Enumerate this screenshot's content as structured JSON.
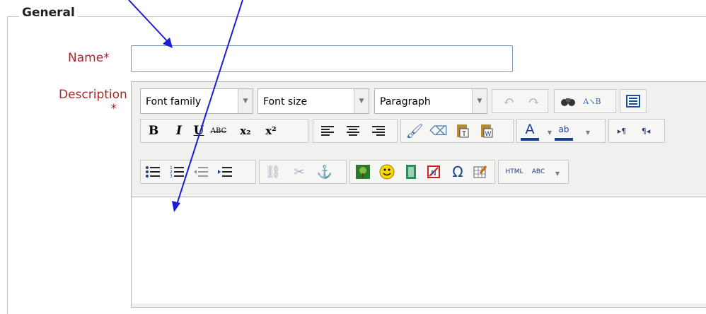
{
  "section": {
    "legend": "General"
  },
  "fields": {
    "name": {
      "label": "Name",
      "required": "*",
      "value": "",
      "placeholder": ""
    },
    "description": {
      "label": "Description",
      "required": "*"
    }
  },
  "toolbar": {
    "font_family": "Font family",
    "font_size": "Font size",
    "paragraph": "Paragraph",
    "bold": "B",
    "italic": "I",
    "underline": "U",
    "strike": "ABC",
    "subscript": "x₂",
    "superscript": "x²",
    "omega": "Ω",
    "html": "HTML",
    "spell": "ABC",
    "ltr": "▸¶",
    "rtl": "¶◂"
  },
  "colors": {
    "label_red": "#a8282a",
    "arrow_blue": "#1c1cd6",
    "input_border": "#7f9db9"
  }
}
